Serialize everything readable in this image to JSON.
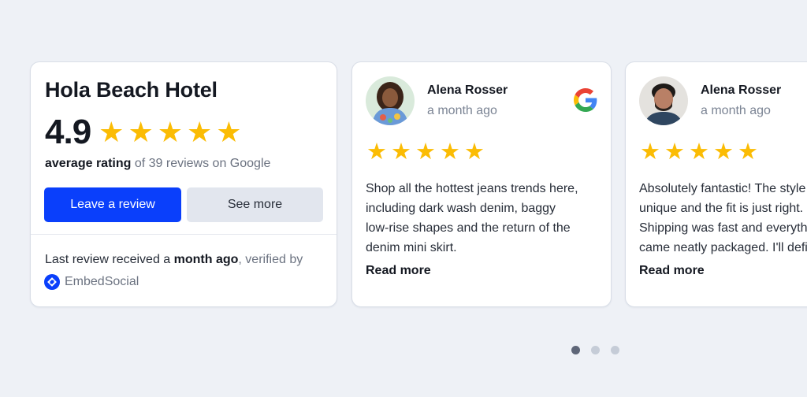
{
  "summary": {
    "business_name": "Hola Beach Hotel",
    "score": "4.9",
    "stars": 5,
    "average_label": "average rating",
    "reviews_text": "of 39 reviews on Google",
    "leave_review_label": "Leave a review",
    "see_more_label": "See more",
    "footer_prefix": "Last review received a ",
    "footer_bold": "month ago",
    "footer_suffix": ", verified by",
    "brand_name": "EmbedSocial",
    "brand_icon": "embedsocial-logo-icon"
  },
  "reviews": [
    {
      "name": "Alena Rosser",
      "time": "a month ago",
      "stars": 5,
      "source_icon": "google-icon",
      "lines": [
        "Shop all the hottest jeans trends here,",
        "including dark wash denim, baggy",
        "low-rise shapes and the return of the",
        "denim mini skirt."
      ],
      "read_more": "Read more"
    },
    {
      "name": "Alena Rosser",
      "time": "a month ago",
      "stars": 5,
      "lines": [
        "Absolutely fantastic! The style is",
        "unique and the fit is just right.",
        "Shipping was fast and everything",
        "came neatly packaged. I'll definitely"
      ],
      "read_more": "Read more"
    }
  ],
  "pagination": {
    "total": 3,
    "active": 1
  },
  "colors": {
    "primary": "#0a3ffb",
    "star": "#fbbc04",
    "background": "#eef1f6"
  }
}
